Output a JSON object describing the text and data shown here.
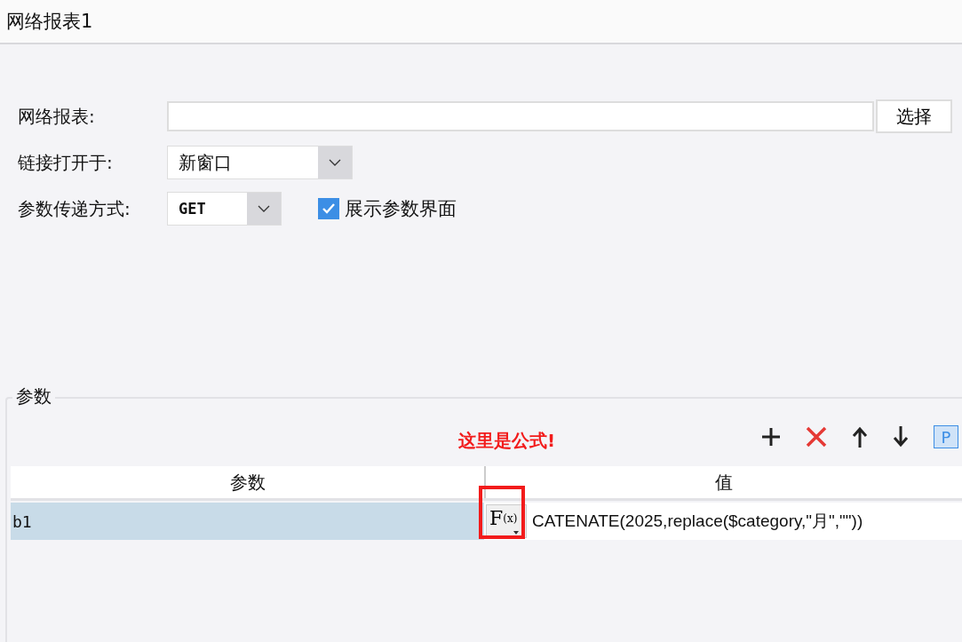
{
  "window": {
    "title": "网络报表1"
  },
  "form": {
    "report": {
      "label": "网络报表:",
      "button": "选择"
    },
    "open_in": {
      "label": "链接打开于:",
      "value": "新窗口"
    },
    "method": {
      "label": "参数传递方式:",
      "value": "GET"
    },
    "show_params": {
      "label": "展示参数界面",
      "checked": true
    }
  },
  "params": {
    "title": "参数",
    "annotation": "这里是公式!",
    "toolbar_p": "P",
    "columns": [
      "参数",
      "值"
    ],
    "rows": [
      {
        "name": "b1",
        "formula_label": "F",
        "formula_sub": "(x)",
        "value": "CATENATE(2025,replace($category,\"月\",\"\"))",
        "selected": true
      }
    ]
  }
}
